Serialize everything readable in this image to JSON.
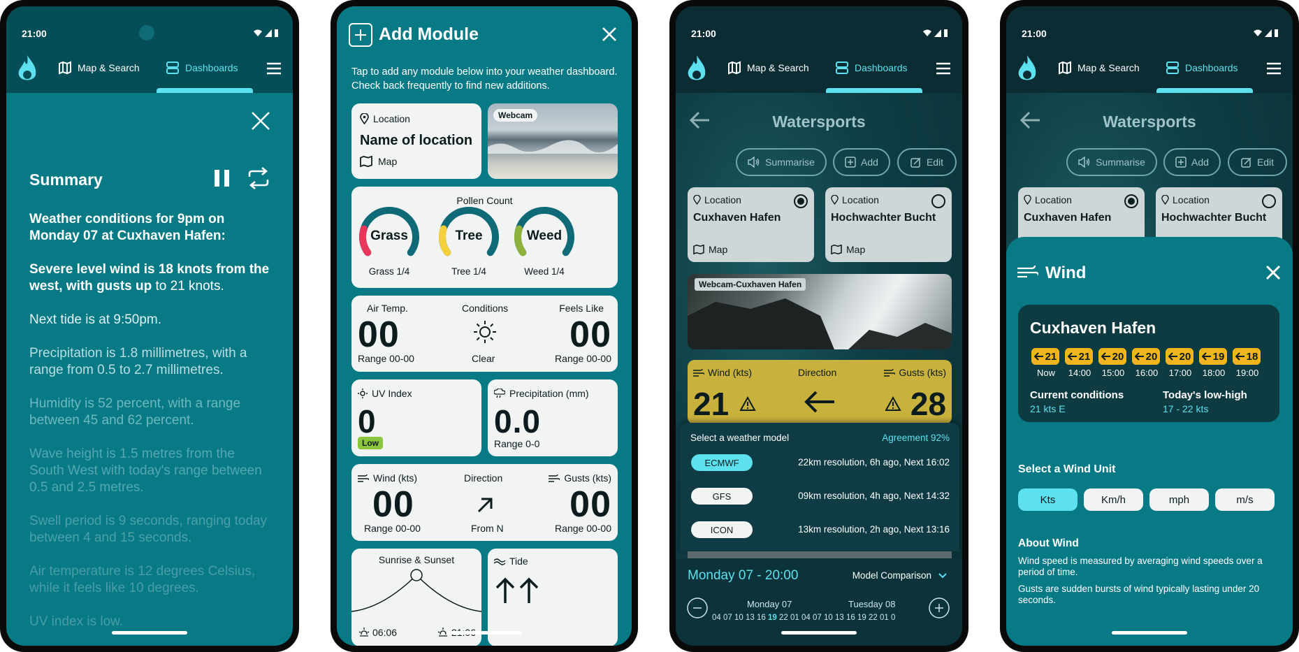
{
  "status": {
    "time": "21:00"
  },
  "nav": {
    "map_search": "Map & Search",
    "dashboards": "Dashboards"
  },
  "summary": {
    "title": "Summary",
    "p1": "Weather conditions for 9pm on Monday 07 at Cuxhaven Hafen:",
    "p2_bold": "Severe level wind is 18 knots from the west, with gusts up",
    "p2_rest": " to 21 knots.",
    "p3": "Next tide is at 9:50pm.",
    "p4": "Precipitation is 1.8 millimetres, with a range from 0.5 to 2.7 millimetres.",
    "p5": "Humidity is 52 percent, with a range between 45 and 62 percent.",
    "p6": "Wave height is 1.5 metres from the South West with today's range between 0.5 and 2.5 metres.",
    "p7": "Swell period is 9 seconds, ranging today between 4 and 15 seconds.",
    "p8": "Air temperature is 12 degrees Celsius, while it feels like 10 degrees.",
    "p9": "UV index is low."
  },
  "add_module": {
    "title": "Add Module",
    "intro": "Tap to add any module below into your weather dashboard. Check back frequently to find new additions.",
    "location": {
      "caption": "Location",
      "name": "Name of location",
      "map": "Map"
    },
    "webcam": "Webcam",
    "pollen": {
      "title": "Pollen Count",
      "items": [
        {
          "name": "Grass",
          "sub": "Grass 1/4",
          "level": 0.25,
          "color": "#e8375a"
        },
        {
          "name": "Tree",
          "sub": "Tree 1/4",
          "level": 0.25,
          "color": "#f4d13c"
        },
        {
          "name": "Weed",
          "sub": "Weed 1/4",
          "level": 0.25,
          "color": "#8db33c"
        }
      ]
    },
    "air": {
      "air_temp": "Air Temp.",
      "air_val": "00",
      "air_range": "Range 00-00",
      "conditions": "Conditions",
      "cond_val": "Clear",
      "feels": "Feels Like",
      "feels_val": "00",
      "feels_range": "Range 00-00"
    },
    "uv": {
      "title": "UV Index",
      "value": "0",
      "badge": "Low"
    },
    "precip": {
      "title": "Precipitation (mm)",
      "value": "0.0",
      "range": "Range 0-0"
    },
    "wind": {
      "wind": "Wind (kts)",
      "wind_val": "00",
      "wind_range": "Range 00-00",
      "direction": "Direction",
      "dir_val": "From N",
      "gusts": "Gusts (kts)",
      "gusts_val": "00",
      "gusts_range": "Range 00-00"
    },
    "sun": {
      "title": "Sunrise & Sunset",
      "rise": "06:06",
      "set": "21:06"
    },
    "tide": {
      "title": "Tide"
    }
  },
  "watersports": {
    "title": "Watersports",
    "summarise": "Summarise",
    "add": "Add",
    "edit": "Edit",
    "loc1": {
      "caption": "Location",
      "name": "Cuxhaven Hafen",
      "map": "Map"
    },
    "loc2": {
      "caption": "Location",
      "name": "Hochwachter Bucht",
      "map": "Map"
    },
    "webcam": "Webcam-Cuxhaven Hafen",
    "wind": {
      "wind": "Wind (kts)",
      "wind_val": "21",
      "direction": "Direction",
      "gusts": "Gusts (kts)",
      "gusts_val": "28"
    },
    "model": {
      "prompt": "Select a weather model",
      "agreement": "Agreement 92%",
      "items": [
        {
          "name": "ECMWF",
          "info": "22km resolution, 6h ago, Next 16:02",
          "selected": true
        },
        {
          "name": "GFS",
          "info": "09km resolution, 4h ago, Next 14:32",
          "selected": false
        },
        {
          "name": "ICON",
          "info": "13km resolution, 2h ago, Next 13:16",
          "selected": false
        }
      ]
    },
    "timeline": {
      "title": "Monday 07 - 20:00",
      "comparison": "Model Comparison",
      "day1": "Monday 07",
      "day2": "Tuesday 08",
      "hours": "04 07 10 13 16 19 22 01 04 07 10 13 16 19 22 01 0",
      "active": "19"
    }
  },
  "wind_panel": {
    "title": "Wind",
    "location": "Cuxhaven Hafen",
    "hours": [
      {
        "speed": "21",
        "time": "Now"
      },
      {
        "speed": "21",
        "time": "14:00"
      },
      {
        "speed": "20",
        "time": "15:00"
      },
      {
        "speed": "20",
        "time": "16:00"
      },
      {
        "speed": "20",
        "time": "17:00"
      },
      {
        "speed": "19",
        "time": "18:00"
      },
      {
        "speed": "18",
        "time": "19:00"
      }
    ],
    "current_label": "Current conditions",
    "current_value": "21 kts E",
    "lowhigh_label": "Today's low-high",
    "lowhigh_value": "17 - 22 kts",
    "unit_title": "Select a Wind Unit",
    "units": [
      "Kts",
      "Km/h",
      "mph",
      "m/s"
    ],
    "about_title": "About Wind",
    "about_1": "Wind speed is measured by averaging wind speeds over a period of time.",
    "about_2": "Gusts are sudden bursts of wind typically lasting under 20 seconds."
  }
}
